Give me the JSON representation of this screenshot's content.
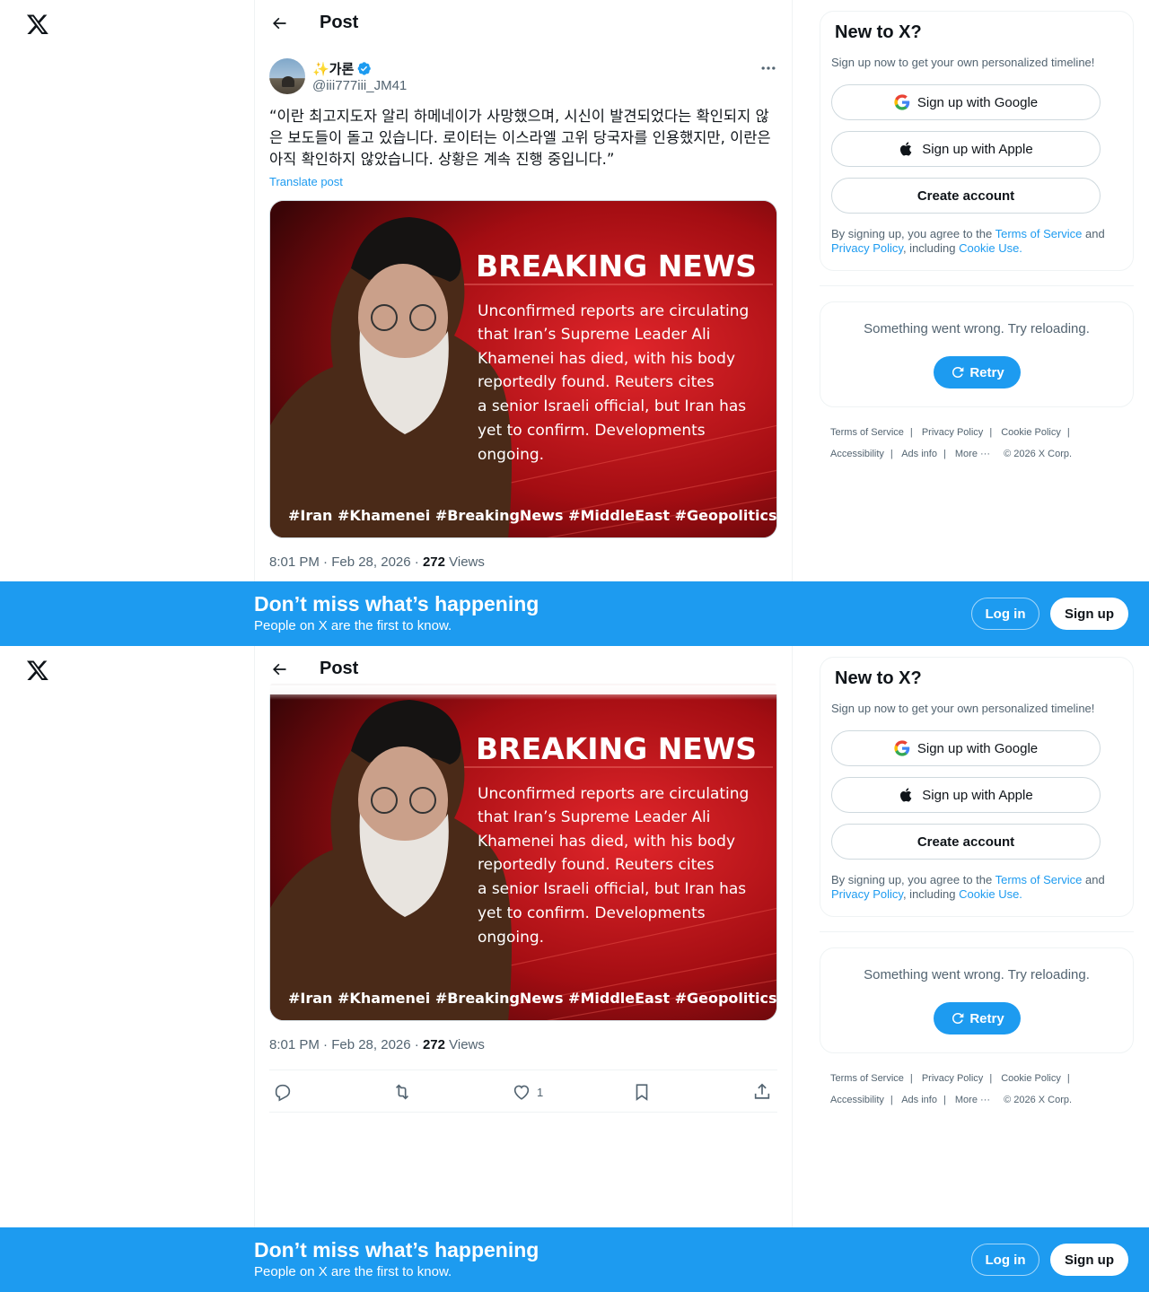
{
  "brand": {
    "accent": "#1d9bf0",
    "text": "#0f1419",
    "muted": "#536471",
    "border": "#eff3f4"
  },
  "header": {
    "title": "Post",
    "back_icon": "back-arrow-icon"
  },
  "post": {
    "display_name": "✨가론",
    "handle": "@iii777iii_JM41",
    "text": "“이란 최고지도자 알리 하메네이가 사망했으며, 시신이 발견되었다는 확인되지 않은 보도들이 돌고 있습니다. 로이터는 이스라엘 고위 당국자를 인용했지만, 이란은 아직 확인하지 않았습니다. 상황은 계속 진행 중입니다.”",
    "translate_label": "Translate post",
    "image": {
      "headline": "BREAKING NEWS",
      "body_lines": [
        "Unconfirmed reports are circulating",
        "that Iran’s Supreme Leader Ali",
        "Khamenei has died, with his body",
        "reportedly found. Reuters cites",
        "a senior Israeli official, but Iran has",
        "yet to confirm. Developments",
        "ongoing."
      ],
      "hashtags": "#Iran #Khamenei #BreakingNews #MiddleEast #Geopolitics"
    },
    "timestamp": "8:01 PM · Feb 28, 2026 · ",
    "views_count": "272",
    "views_label": " Views",
    "likes_count": "1"
  },
  "sidebar": {
    "title": "New to X?",
    "subtitle": "Sign up now to get your own personalized timeline!",
    "google_label": "Sign up with Google",
    "apple_label": "Sign up with Apple",
    "create_label": "Create account",
    "legal_prefix": "By signing up, you agree to the ",
    "terms_link": "Terms of Service",
    "legal_and": " and ",
    "privacy_link": "Privacy Policy",
    "legal_including": ", including ",
    "cookie_link": "Cookie Use.",
    "error_text": "Something went wrong. Try reloading.",
    "retry_label": "Retry"
  },
  "footer": {
    "terms": "Terms of Service",
    "privacy": "Privacy Policy",
    "cookie": "Cookie Policy",
    "accessibility": "Accessibility",
    "ads": "Ads info",
    "more": "More ···",
    "copyright": "© 2026 X Corp.",
    "sep": "|"
  },
  "banner": {
    "title": "Don’t miss what’s happening",
    "subtitle": "People on X are the first to know.",
    "login_label": "Log in",
    "signup_label": "Sign up"
  }
}
